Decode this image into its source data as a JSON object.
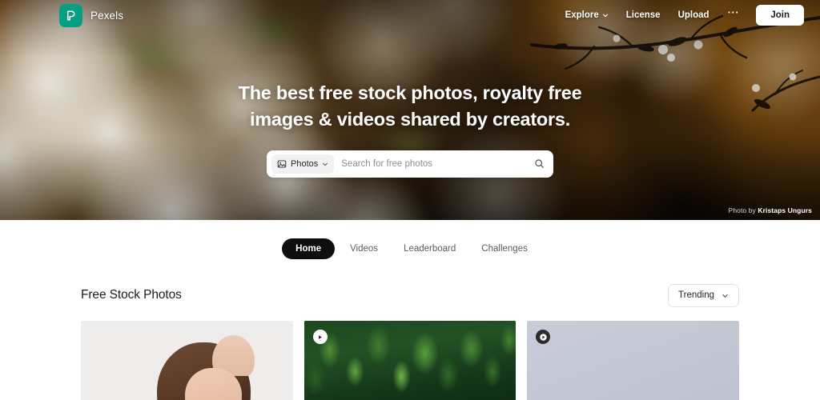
{
  "header": {
    "logo_icon": "pexels-logo-icon",
    "brand_name": "Pexels",
    "brand_color": "#05A081",
    "nav": [
      {
        "label": "Explore",
        "icon": "chevron-down-icon",
        "has_chevron": true
      },
      {
        "label": "License",
        "has_chevron": false
      },
      {
        "label": "Upload",
        "has_chevron": false
      }
    ],
    "more_label": "···",
    "more_icon": "ellipsis-icon",
    "join_label": "Join"
  },
  "hero": {
    "title_line1": "The best free stock photos, royalty free",
    "title_line2": "images & videos shared by creators.",
    "search": {
      "type_label": "Photos",
      "type_icon": "image-icon",
      "chevron_icon": "chevron-down-icon",
      "placeholder": "Search for free photos",
      "value": "",
      "submit_icon": "search-icon"
    },
    "credit_prefix": "Photo by ",
    "credit_author": "Kristaps Ungurs"
  },
  "tabs": [
    {
      "label": "Home",
      "active": true
    },
    {
      "label": "Videos",
      "active": false
    },
    {
      "label": "Leaderboard",
      "active": false
    },
    {
      "label": "Challenges",
      "active": false
    }
  ],
  "section": {
    "title": "Free Stock Photos",
    "sort_label": "Trending",
    "sort_icon": "chevron-down-icon"
  },
  "grid": [
    {
      "name": "photo-portrait",
      "kind": "photo",
      "badge": null
    },
    {
      "name": "video-aerial-forest",
      "kind": "video",
      "badge": "play-icon",
      "badge_style": "light"
    },
    {
      "name": "video-placeholder",
      "kind": "video",
      "badge": "play-icon",
      "badge_style": "dark"
    }
  ]
}
